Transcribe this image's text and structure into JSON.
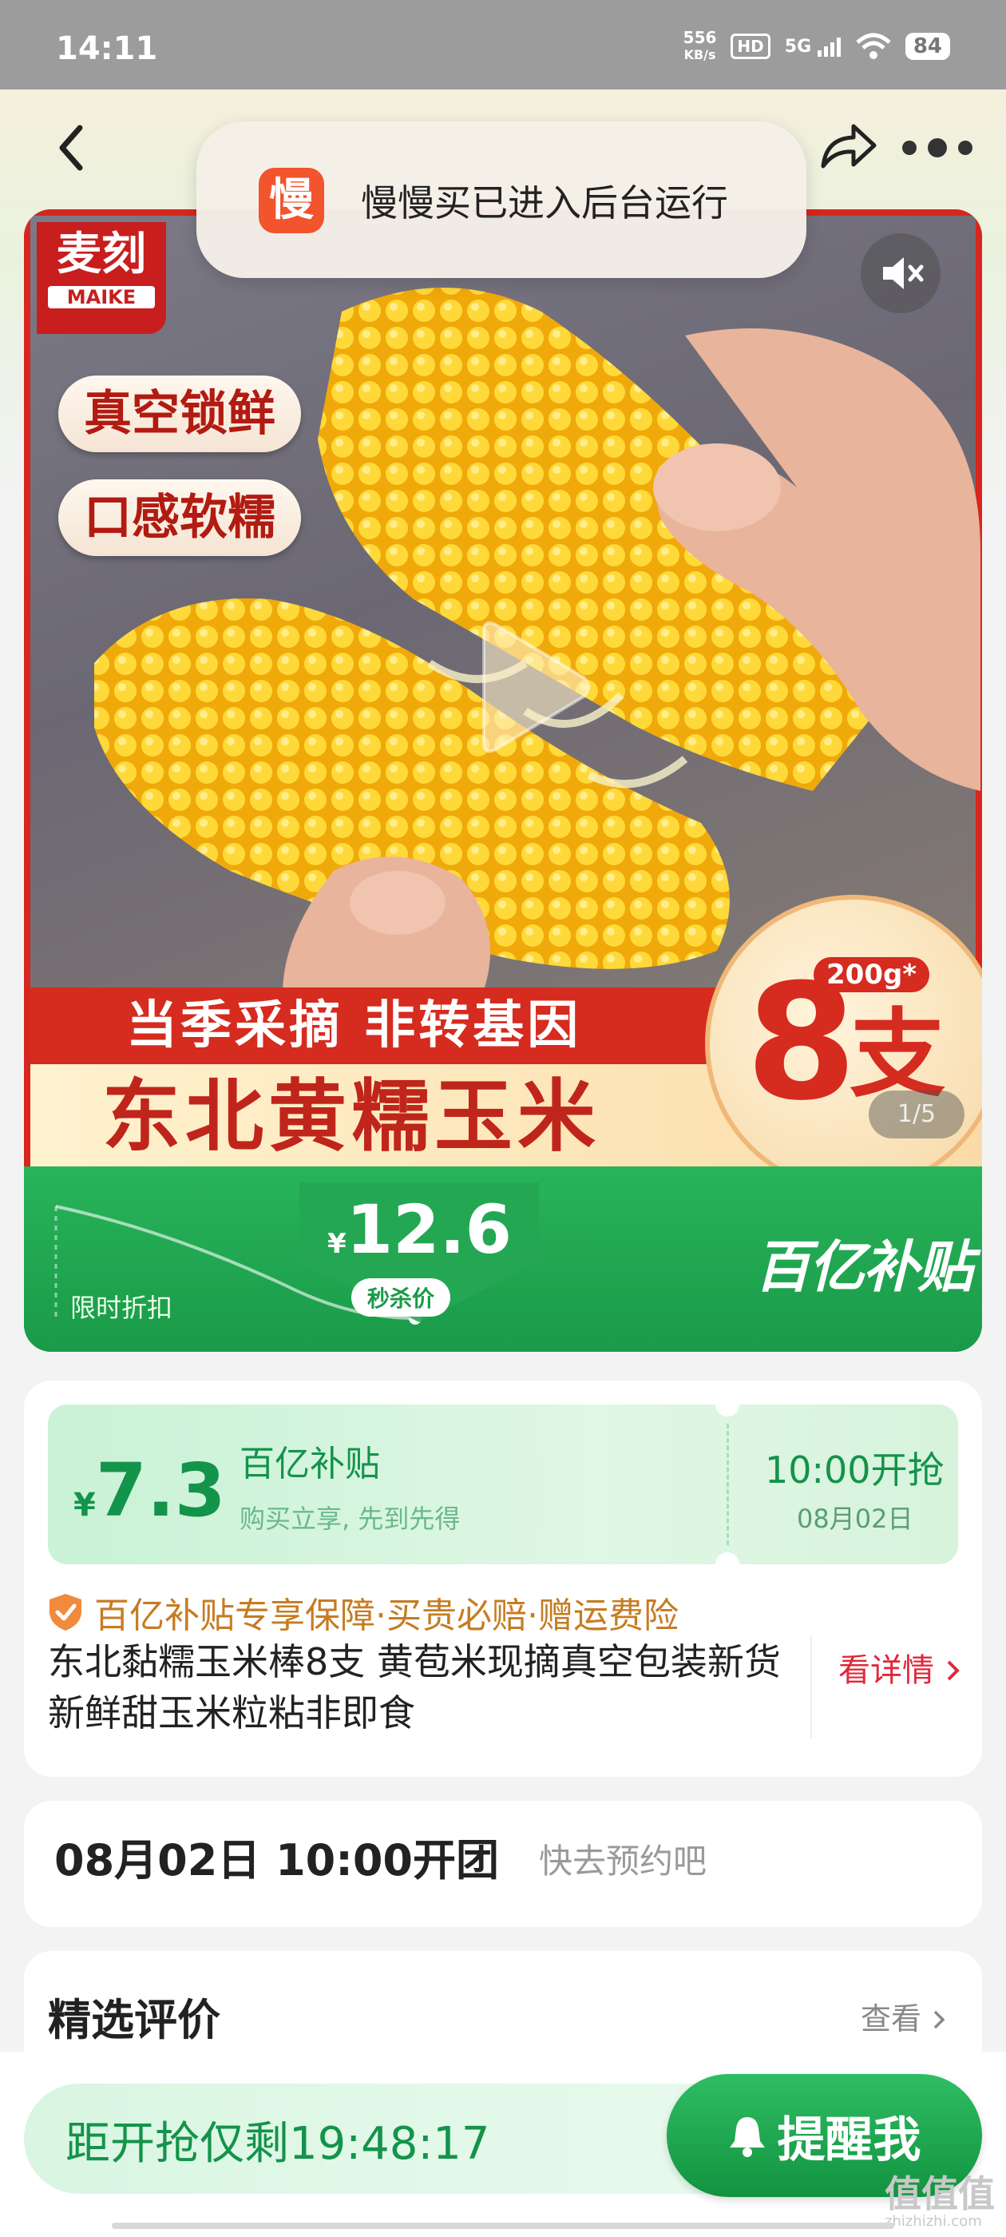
{
  "status_bar": {
    "time": "14:11",
    "net_speed_value": "556",
    "net_speed_unit": "KB/s",
    "hd_label": "HD",
    "signal_label": "5G",
    "battery": "84"
  },
  "toast": {
    "icon_char": "慢",
    "message": "慢慢买已进入后台运行"
  },
  "product_image": {
    "brand_cn": "麦刻",
    "brand_en": "MAIKE",
    "tags": [
      "真空锁鲜",
      "口感软糯"
    ],
    "banner_line1": "当季采摘 非转基因",
    "banner_line2": "东北黄糯玉米",
    "weight_badge": "200g*",
    "count_number": "8",
    "count_unit": "支",
    "page_indicator": "1/5"
  },
  "price_band": {
    "currency": "¥",
    "price": "12.6",
    "price_tag": "秒杀价",
    "limited_label": "限时折扣",
    "subsidy_logo": "百亿补贴"
  },
  "coupon": {
    "currency": "¥",
    "amount": "7.3",
    "title": "百亿补贴",
    "subtitle": "购买立享, 先到先得",
    "start_time": "10:00开抢",
    "start_date": "08月02日"
  },
  "guarantee": "百亿补贴专享保障·买贵必赔·赠运费险",
  "product_title": "东北黏糯玉米棒8支 黄苞米现摘真空包装新货新鲜甜玉米粒粘非即食",
  "detail_link": "看详情",
  "group_buy": {
    "time": "08月02日 10:00开团",
    "hint": "快去预约吧"
  },
  "reviews": {
    "title": "精选评价",
    "link": "查看"
  },
  "bottom_bar": {
    "countdown": "距开抢仅剩19:48:17",
    "remind_button": "提醒我"
  },
  "watermark": {
    "main": "值值值",
    "sub": "zhizhizhi.com"
  },
  "colors": {
    "accent_green": "#14934a",
    "price_red": "#d62b1f",
    "link_red": "#e0283a",
    "guarantee_orange": "#c67c22"
  }
}
